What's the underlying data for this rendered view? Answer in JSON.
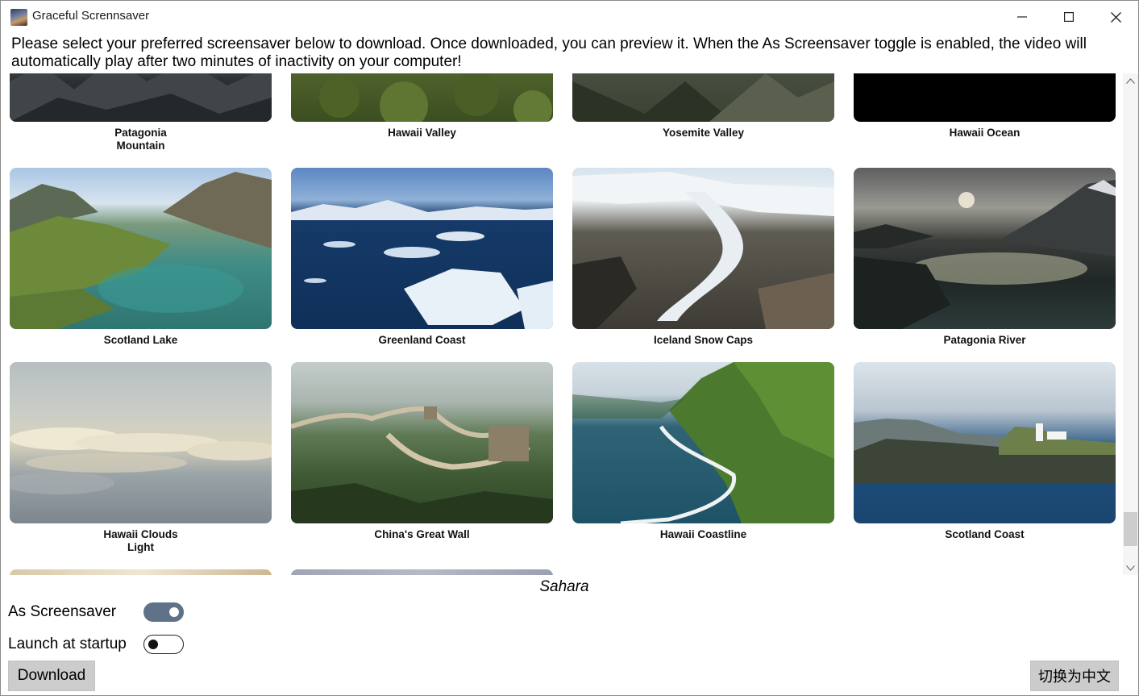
{
  "window": {
    "title": "Graceful Scrennsaver"
  },
  "description": "Please select your preferred screensaver below to download. Once downloaded, you can preview it. When the As Screensaver toggle is enabled, the video will automatically play after two minutes of inactivity on your computer!",
  "videos": [
    {
      "label": "Patagonia\nMountain"
    },
    {
      "label": "Hawaii Valley"
    },
    {
      "label": "Yosemite Valley"
    },
    {
      "label": "Hawaii Ocean"
    },
    {
      "label": "Scotland Lake"
    },
    {
      "label": "Greenland Coast"
    },
    {
      "label": "Iceland Snow Caps"
    },
    {
      "label": "Patagonia River"
    },
    {
      "label": "Hawaii Clouds\nLight"
    },
    {
      "label": "China's Great Wall"
    },
    {
      "label": "Hawaii Coastline"
    },
    {
      "label": "Scotland Coast"
    }
  ],
  "selected_video": "Sahara",
  "options": {
    "as_screensaver": {
      "label": "As Screensaver",
      "enabled": true
    },
    "launch_at_startup": {
      "label": "Launch at startup",
      "enabled": false
    }
  },
  "buttons": {
    "download": "Download",
    "language": "切换为中文"
  },
  "icons": {
    "minimize": "minimize-icon",
    "maximize": "maximize-icon",
    "close": "close-icon"
  }
}
